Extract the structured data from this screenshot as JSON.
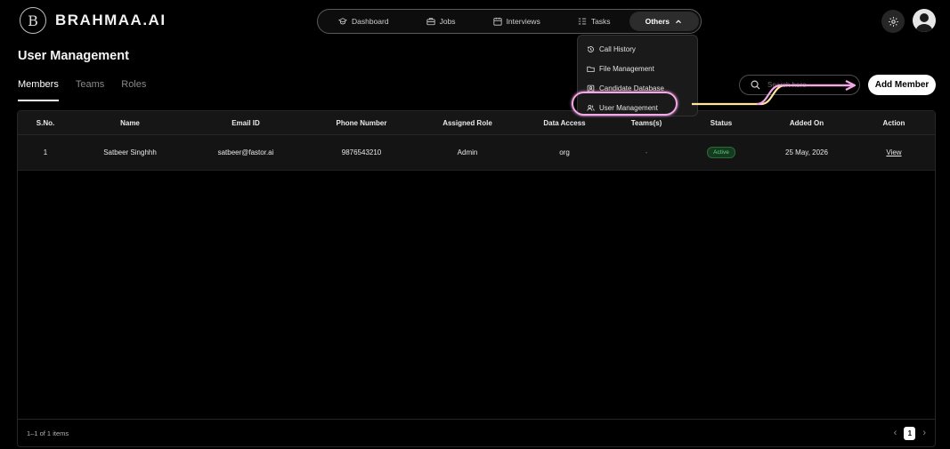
{
  "brand": {
    "logo_letter": "B",
    "name": "BRAHMAA.AI"
  },
  "topnav": {
    "items": [
      {
        "label": "Dashboard",
        "icon": "graduation-cap-icon"
      },
      {
        "label": "Jobs",
        "icon": "briefcase-icon"
      },
      {
        "label": "Interviews",
        "icon": "calendar-icon"
      },
      {
        "label": "Tasks",
        "icon": "checklist-icon"
      }
    ],
    "active": {
      "label": "Others",
      "icon": "chevron-up-icon"
    }
  },
  "dropdown": {
    "items": [
      {
        "label": "Call History",
        "icon": "history-icon"
      },
      {
        "label": "File Management",
        "icon": "folder-icon"
      },
      {
        "label": "Candidate Database",
        "icon": "database-icon"
      },
      {
        "label": "User Management",
        "icon": "users-icon"
      }
    ]
  },
  "page": {
    "title": "User Management"
  },
  "tabs": [
    {
      "label": "Members",
      "active": true
    },
    {
      "label": "Teams",
      "active": false
    },
    {
      "label": "Roles",
      "active": false
    }
  ],
  "search": {
    "placeholder": "Search here"
  },
  "add_member": {
    "label": "Add Member"
  },
  "table": {
    "columns": [
      "S.No.",
      "Name",
      "Email ID",
      "Phone Number",
      "Assigned Role",
      "Data Access",
      "Teams(s)",
      "Status",
      "Added On",
      "Action"
    ],
    "rows": [
      {
        "sno": "1",
        "name": "Satbeer Singhhh",
        "email": "satbeer@fastor.ai",
        "phone": "9876543210",
        "role": "Admin",
        "access": "org",
        "teams": "-",
        "status": "Active",
        "added": "25 May, 2026",
        "action": "View"
      }
    ],
    "footer_count": "1–1 of 1 items",
    "current_page": "1"
  },
  "colors": {
    "background": "#000000",
    "status_active": "#59d37a",
    "annotation": "#f3a6e8"
  }
}
